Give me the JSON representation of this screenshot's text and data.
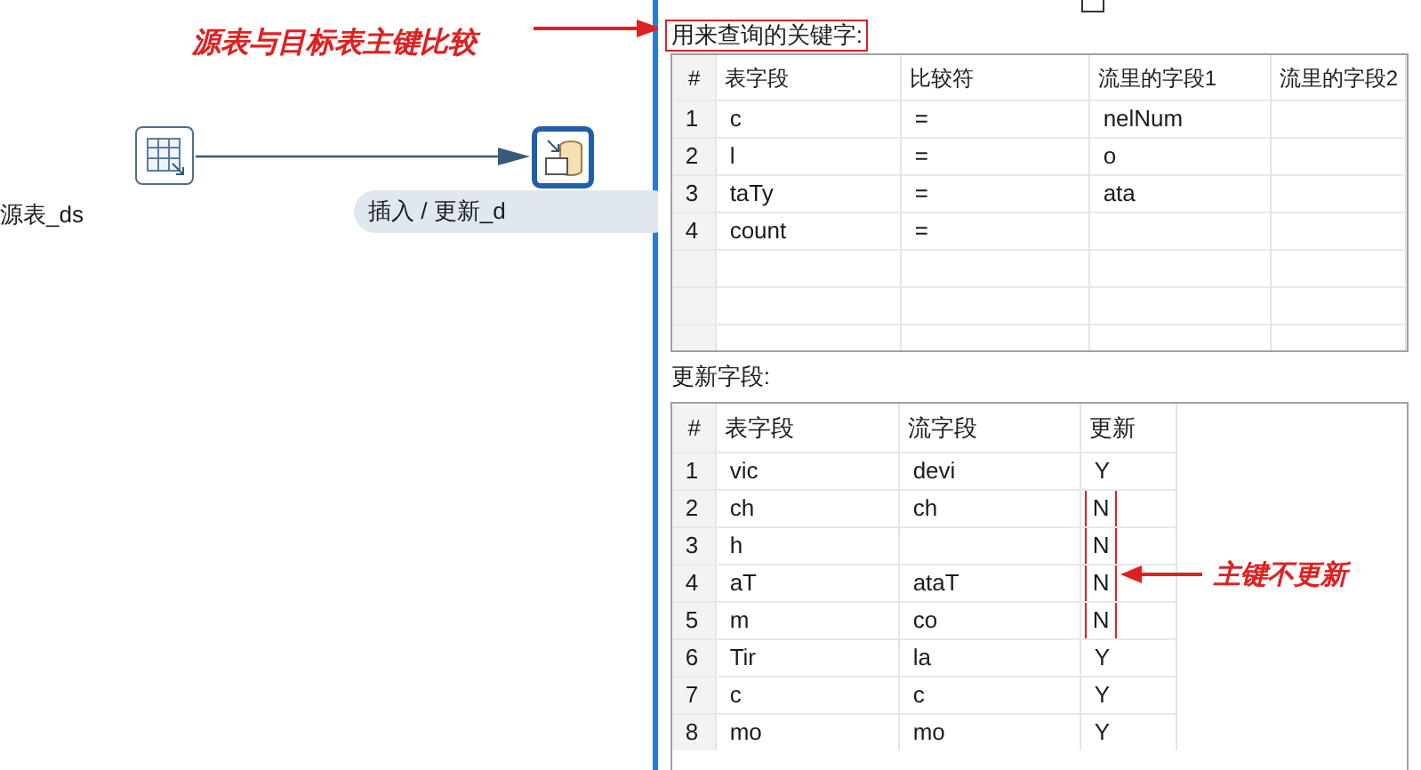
{
  "canvas": {
    "annotation": "源表与目标表主键比较",
    "source_step": {
      "label": "源表_ds"
    },
    "target_step": {
      "label": "插入 / 更新_d"
    }
  },
  "panel": {
    "top_checkbox": {
      "checked": false
    },
    "key_table": {
      "label": "用来查询的关键字:",
      "columns": [
        "#",
        "表字段",
        "比较符",
        "流里的字段1",
        "流里的字段2"
      ],
      "rows": [
        [
          "1",
          "c",
          "=",
          "nelNum",
          ""
        ],
        [
          "2",
          "l",
          "=",
          "o",
          ""
        ],
        [
          "3",
          "taTy",
          "=",
          "ata",
          ""
        ],
        [
          "4",
          "count",
          "=",
          "",
          ""
        ]
      ]
    },
    "update_table": {
      "label": "更新字段:",
      "columns": [
        "#",
        "表字段",
        "流字段",
        "更新"
      ],
      "rows": [
        {
          "cells": [
            "1",
            "vic",
            "devi",
            "Y"
          ],
          "highlighted": false
        },
        {
          "cells": [
            "2",
            "ch",
            "ch",
            "N"
          ],
          "highlighted": true
        },
        {
          "cells": [
            "3",
            "h",
            "",
            "N"
          ],
          "highlighted": true
        },
        {
          "cells": [
            "4",
            "aT",
            "ataT",
            "N"
          ],
          "highlighted": true
        },
        {
          "cells": [
            "5",
            "m",
            "co",
            "N"
          ],
          "highlighted": true
        },
        {
          "cells": [
            "6",
            "Tir",
            "la",
            "Y"
          ],
          "highlighted": false
        },
        {
          "cells": [
            "7",
            "c",
            "c",
            "Y"
          ],
          "highlighted": false
        },
        {
          "cells": [
            "8",
            "mo",
            "mo",
            "Y"
          ],
          "highlighted": false
        }
      ]
    },
    "annotation": "主键不更新"
  }
}
